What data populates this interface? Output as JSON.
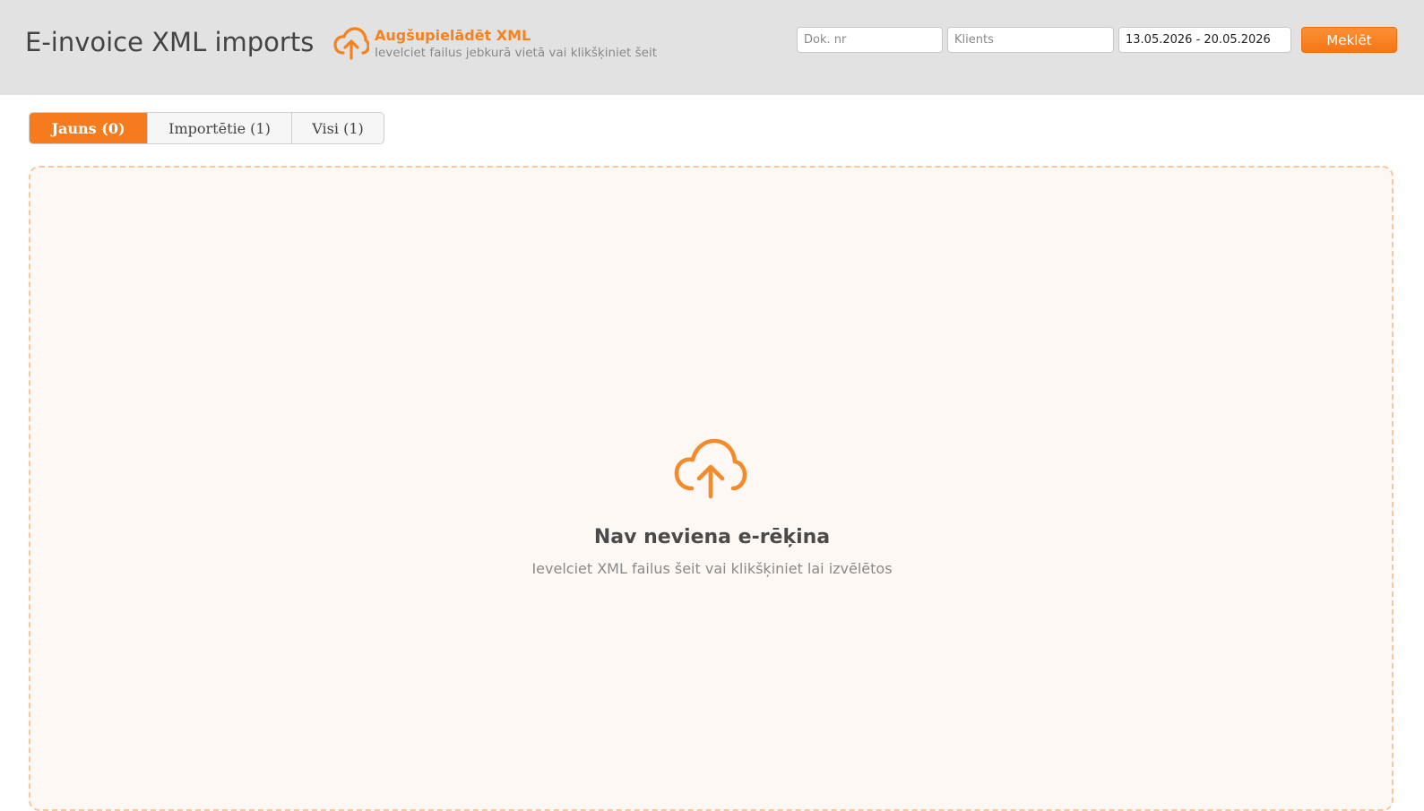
{
  "header": {
    "title": "E-invoice XML imports",
    "upload": {
      "title": "Augšupielādēt XML",
      "subtitle": "Ievelciet failus jebkurā vietā vai klikšķiniet šeit",
      "icon": "cloud-upload-icon"
    },
    "search": {
      "doc_placeholder": "Dok. nr",
      "doc_value": "",
      "client_placeholder": "Klients",
      "client_value": "",
      "date_range_value": "13.05.2026 - 20.05.2026",
      "button_label": "Meklēt"
    }
  },
  "tabs": [
    {
      "label": "Jauns (0)",
      "active": true
    },
    {
      "label": "Importētie (1)",
      "active": false
    },
    {
      "label": "Visi (1)",
      "active": false
    }
  ],
  "empty_state": {
    "icon": "cloud-upload-icon",
    "title": "Nav neviena e-rēķina",
    "subtitle": "Ievelciet XML failus šeit vai klikšķiniet lai izvēlētos"
  },
  "colors": {
    "accent": "#f57b1c",
    "header_bg": "#e2e2e2",
    "dropzone_bg": "#fdf8f4",
    "dropzone_border": "#f8c79a"
  }
}
